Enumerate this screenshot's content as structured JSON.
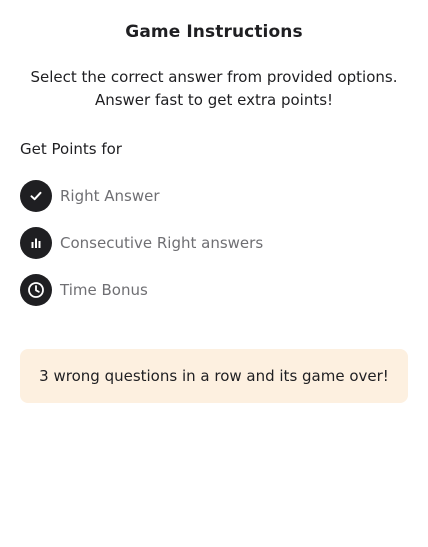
{
  "title": "Game Instructions",
  "intro": {
    "line1": "Select the correct answer from provided options.",
    "line2": "Answer fast to get extra points!"
  },
  "points": {
    "heading": "Get Points for",
    "items": [
      {
        "icon": "checkmark-icon",
        "label": "Right Answer"
      },
      {
        "icon": "bar-chart-icon",
        "label": "Consecutive Right answers"
      },
      {
        "icon": "clock-icon",
        "label": "Time Bonus"
      }
    ]
  },
  "warning": {
    "text": "3 wrong questions in a row and its game over!",
    "background": "#fdf0e0"
  },
  "colors": {
    "text": "#1f1f22",
    "muted": "#6f6f73",
    "icon_badge": "#1f1f22"
  }
}
